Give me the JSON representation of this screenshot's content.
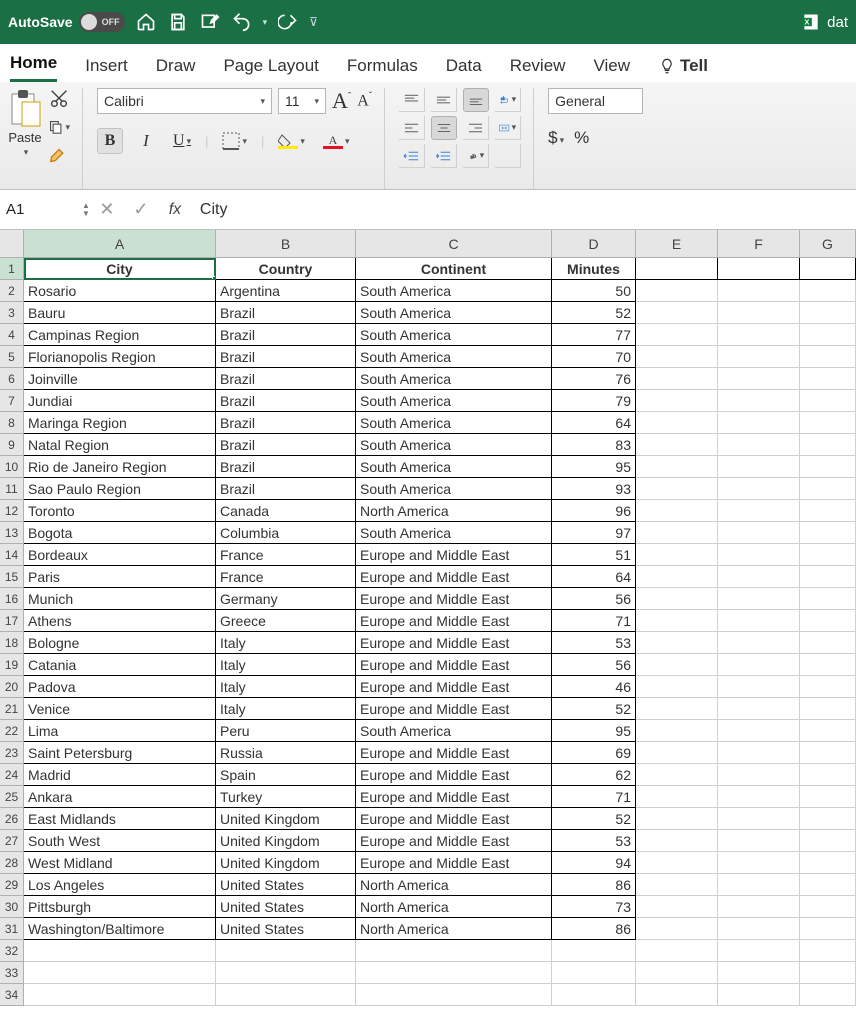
{
  "titlebar": {
    "autosave_label": "AutoSave",
    "autosave_state": "OFF",
    "doc_name": "dat"
  },
  "ribbon_tabs": {
    "home": "Home",
    "insert": "Insert",
    "draw": "Draw",
    "page_layout": "Page Layout",
    "formulas": "Formulas",
    "data": "Data",
    "review": "Review",
    "view": "View",
    "tell": "Tell"
  },
  "ribbon": {
    "paste_label": "Paste",
    "font_name": "Calibri",
    "font_size": "11",
    "number_format": "General",
    "currency": "$",
    "percent": "%"
  },
  "formula_bar": {
    "cell_ref": "A1",
    "fx_label": "fx",
    "value": "City"
  },
  "columns": [
    "A",
    "B",
    "C",
    "D",
    "E",
    "F",
    "G"
  ],
  "headers": {
    "A": "City",
    "B": "Country",
    "C": "Continent",
    "D": "Minutes"
  },
  "data": [
    {
      "r": 2,
      "A": "Rosario",
      "B": "Argentina",
      "C": "South America",
      "D": "50"
    },
    {
      "r": 3,
      "A": "Bauru",
      "B": "Brazil",
      "C": "South America",
      "D": "52"
    },
    {
      "r": 4,
      "A": "Campinas Region",
      "B": "Brazil",
      "C": "South America",
      "D": "77"
    },
    {
      "r": 5,
      "A": "Florianopolis Region",
      "B": "Brazil",
      "C": "South America",
      "D": "70"
    },
    {
      "r": 6,
      "A": "Joinville",
      "B": "Brazil",
      "C": "South America",
      "D": "76"
    },
    {
      "r": 7,
      "A": "Jundiai",
      "B": "Brazil",
      "C": "South America",
      "D": "79"
    },
    {
      "r": 8,
      "A": "Maringa Region",
      "B": "Brazil",
      "C": "South America",
      "D": "64"
    },
    {
      "r": 9,
      "A": "Natal Region",
      "B": "Brazil",
      "C": "South America",
      "D": "83"
    },
    {
      "r": 10,
      "A": "Rio de Janeiro Region",
      "B": "Brazil",
      "C": "South America",
      "D": "95"
    },
    {
      "r": 11,
      "A": "Sao Paulo Region",
      "B": "Brazil",
      "C": "South America",
      "D": "93"
    },
    {
      "r": 12,
      "A": "Toronto",
      "B": "Canada",
      "C": "North America",
      "D": "96"
    },
    {
      "r": 13,
      "A": "Bogota",
      "B": "Columbia",
      "C": "South America",
      "D": "97"
    },
    {
      "r": 14,
      "A": "Bordeaux",
      "B": "France",
      "C": "Europe and Middle East",
      "D": "51"
    },
    {
      "r": 15,
      "A": "Paris",
      "B": "France",
      "C": "Europe and Middle East",
      "D": "64"
    },
    {
      "r": 16,
      "A": "Munich",
      "B": "Germany",
      "C": "Europe and Middle East",
      "D": "56"
    },
    {
      "r": 17,
      "A": "Athens",
      "B": "Greece",
      "C": "Europe and Middle East",
      "D": "71"
    },
    {
      "r": 18,
      "A": "Bologne",
      "B": "Italy",
      "C": "Europe and Middle East",
      "D": "53"
    },
    {
      "r": 19,
      "A": "Catania",
      "B": "Italy",
      "C": "Europe and Middle East",
      "D": "56"
    },
    {
      "r": 20,
      "A": "Padova",
      "B": "Italy",
      "C": "Europe and Middle East",
      "D": "46"
    },
    {
      "r": 21,
      "A": "Venice",
      "B": "Italy",
      "C": "Europe and Middle East",
      "D": "52"
    },
    {
      "r": 22,
      "A": "Lima",
      "B": "Peru",
      "C": "South America",
      "D": "95"
    },
    {
      "r": 23,
      "A": "Saint Petersburg",
      "B": "Russia",
      "C": "Europe and Middle East",
      "D": "69"
    },
    {
      "r": 24,
      "A": "Madrid",
      "B": "Spain",
      "C": "Europe and Middle East",
      "D": "62"
    },
    {
      "r": 25,
      "A": "Ankara",
      "B": "Turkey",
      "C": "Europe and Middle East",
      "D": "71"
    },
    {
      "r": 26,
      "A": "East Midlands",
      "B": "United Kingdom",
      "C": "Europe and Middle East",
      "D": "52"
    },
    {
      "r": 27,
      "A": "South West",
      "B": "United Kingdom",
      "C": "Europe and Middle East",
      "D": "53"
    },
    {
      "r": 28,
      "A": "West Midland",
      "B": "United Kingdom",
      "C": "Europe and Middle East",
      "D": "94"
    },
    {
      "r": 29,
      "A": "Los Angeles",
      "B": "United States",
      "C": "North America",
      "D": "86"
    },
    {
      "r": 30,
      "A": "Pittsburgh",
      "B": "United States",
      "C": "North America",
      "D": "73"
    },
    {
      "r": 31,
      "A": "Washington/Baltimore",
      "B": "United States",
      "C": "North America",
      "D": "86"
    }
  ],
  "empty_rows": [
    32,
    33,
    34
  ]
}
